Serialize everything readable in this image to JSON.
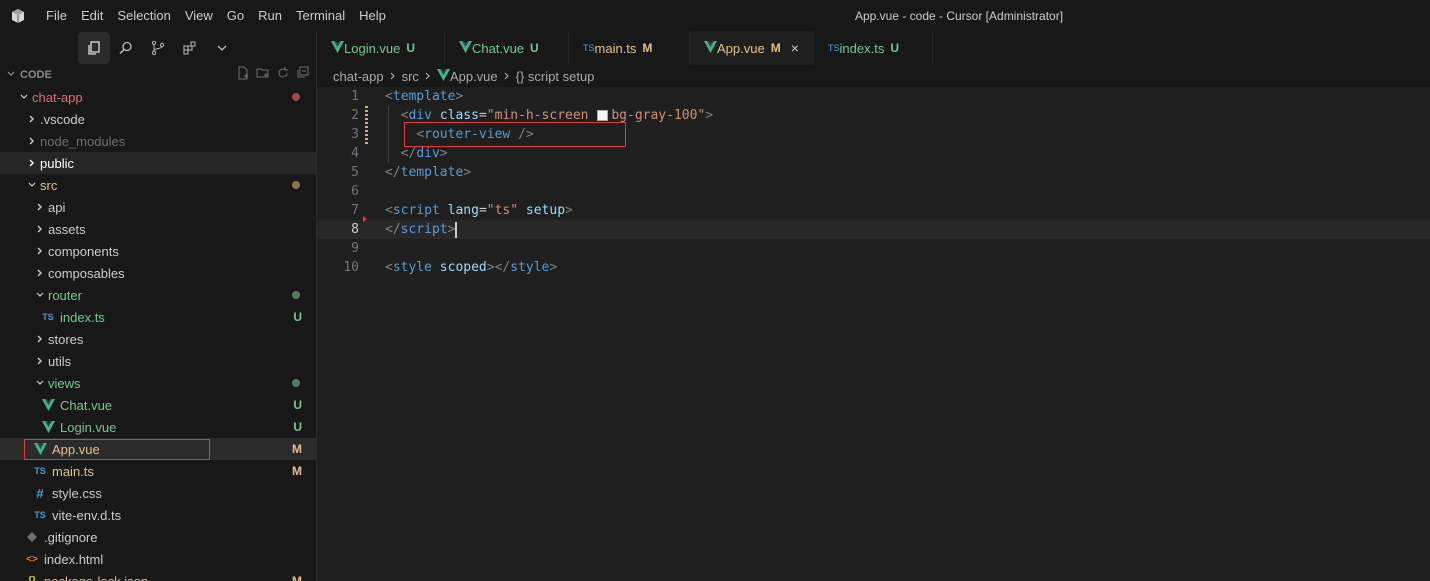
{
  "titlebar": {
    "menu": [
      "File",
      "Edit",
      "Selection",
      "View",
      "Go",
      "Run",
      "Terminal",
      "Help"
    ],
    "window_title": "App.vue - code - Cursor [Administrator]"
  },
  "sidebar": {
    "icons": [
      "files-icon",
      "search-icon",
      "source-control-icon",
      "extensions-icon",
      "chevron-down-icon"
    ],
    "section_title": "CODE",
    "tree": [
      {
        "label": "chat-app",
        "kind": "folder-open",
        "depth": 0,
        "color": "#e06c75",
        "status": "dot",
        "status_color": "#9b4a4a"
      },
      {
        "label": ".vscode",
        "kind": "folder",
        "depth": 1,
        "color": "#cccccc"
      },
      {
        "label": "node_modules",
        "kind": "folder",
        "depth": 1,
        "color": "#6e6e6e"
      },
      {
        "label": "public",
        "kind": "folder",
        "depth": 1,
        "color": "#ffffff",
        "highlight": true
      },
      {
        "label": "src",
        "kind": "folder-open",
        "depth": 1,
        "color": "#e2c08d",
        "status": "dot",
        "status_color": "#8a7550"
      },
      {
        "label": "api",
        "kind": "folder",
        "depth": 2,
        "color": "#cccccc"
      },
      {
        "label": "assets",
        "kind": "folder",
        "depth": 2,
        "color": "#cccccc"
      },
      {
        "label": "components",
        "kind": "folder",
        "depth": 2,
        "color": "#cccccc"
      },
      {
        "label": "composables",
        "kind": "folder",
        "depth": 2,
        "color": "#cccccc"
      },
      {
        "label": "router",
        "kind": "folder-open",
        "depth": 2,
        "color": "#73c991",
        "status": "dot",
        "status_color": "#4e7a5e"
      },
      {
        "label": "index.ts",
        "kind": "ts",
        "depth": 3,
        "color": "#73c991",
        "status": "U",
        "status_color": "#73c991"
      },
      {
        "label": "stores",
        "kind": "folder",
        "depth": 2,
        "color": "#cccccc"
      },
      {
        "label": "utils",
        "kind": "folder",
        "depth": 2,
        "color": "#cccccc"
      },
      {
        "label": "views",
        "kind": "folder-open",
        "depth": 2,
        "color": "#73c991",
        "status": "dot",
        "status_color": "#4e7a5e"
      },
      {
        "label": "Chat.vue",
        "kind": "vue",
        "depth": 3,
        "color": "#73c991",
        "status": "U",
        "status_color": "#73c991"
      },
      {
        "label": "Login.vue",
        "kind": "vue",
        "depth": 3,
        "color": "#73c991",
        "status": "U",
        "status_color": "#73c991"
      },
      {
        "label": "App.vue",
        "kind": "vue",
        "depth": 2,
        "color": "#e2c08d",
        "status": "M",
        "status_color": "#e2c08d",
        "selected": true
      },
      {
        "label": "main.ts",
        "kind": "ts",
        "depth": 2,
        "color": "#e2c08d",
        "status": "M",
        "status_color": "#e2c08d"
      },
      {
        "label": "style.css",
        "kind": "css",
        "depth": 2,
        "color": "#cccccc"
      },
      {
        "label": "vite-env.d.ts",
        "kind": "ts",
        "depth": 2,
        "color": "#cccccc"
      },
      {
        "label": ".gitignore",
        "kind": "git",
        "depth": 1,
        "color": "#cccccc"
      },
      {
        "label": "index.html",
        "kind": "html",
        "depth": 1,
        "color": "#cccccc"
      },
      {
        "label": "package-lock.json",
        "kind": "json",
        "depth": 1,
        "color": "#e2c08d",
        "status": "M",
        "status_color": "#e2c08d"
      }
    ]
  },
  "tabs": [
    {
      "label": "Login.vue",
      "kind": "vue",
      "mark": "U",
      "label_color": "#73c991",
      "mark_color": "#73c991"
    },
    {
      "label": "Chat.vue",
      "kind": "vue",
      "mark": "U",
      "label_color": "#73c991",
      "mark_color": "#73c991"
    },
    {
      "label": "main.ts",
      "kind": "ts",
      "mark": "M",
      "label_color": "#e2c08d",
      "mark_color": "#e2c08d"
    },
    {
      "label": "App.vue",
      "kind": "vue",
      "mark": "M",
      "label_color": "#e2c08d",
      "mark_color": "#e2c08d",
      "active": true,
      "close": "×"
    },
    {
      "label": "index.ts",
      "kind": "ts",
      "mark": "U",
      "label_color": "#73c991",
      "mark_color": "#73c991"
    }
  ],
  "breadcrumb": [
    "chat-app",
    "src",
    "App.vue",
    "{} script setup"
  ],
  "editor": {
    "current_line": 8,
    "lines": [
      {
        "n": "1",
        "tokens": [
          [
            "tag-br",
            "<"
          ],
          [
            "tag",
            "template"
          ],
          [
            "tag-br",
            ">"
          ]
        ]
      },
      {
        "n": "2",
        "tokens": [
          [
            "plain",
            "  "
          ],
          [
            "tag-br",
            "<"
          ],
          [
            "tag",
            "div"
          ],
          [
            "plain",
            " "
          ],
          [
            "attr",
            "class"
          ],
          [
            "plain",
            "="
          ],
          [
            "str",
            "\"min-h-screen "
          ],
          [
            "swatch",
            ""
          ],
          [
            "str",
            "bg-gray-100\""
          ],
          [
            "tag-br",
            ">"
          ]
        ]
      },
      {
        "n": "3",
        "tokens": [
          [
            "plain",
            "    "
          ],
          [
            "tag-br",
            "<"
          ],
          [
            "tag",
            "router-view"
          ],
          [
            "plain",
            " "
          ],
          [
            "tag-br",
            "/>"
          ]
        ]
      },
      {
        "n": "4",
        "tokens": [
          [
            "plain",
            "  "
          ],
          [
            "tag-br",
            "</"
          ],
          [
            "tag",
            "div"
          ],
          [
            "tag-br",
            ">"
          ]
        ]
      },
      {
        "n": "5",
        "tokens": [
          [
            "tag-br",
            "</"
          ],
          [
            "tag",
            "template"
          ],
          [
            "tag-br",
            ">"
          ]
        ]
      },
      {
        "n": "6",
        "tokens": []
      },
      {
        "n": "7",
        "tokens": [
          [
            "tag-br",
            "<"
          ],
          [
            "tag",
            "script"
          ],
          [
            "plain",
            " "
          ],
          [
            "attr",
            "lang"
          ],
          [
            "plain",
            "="
          ],
          [
            "str",
            "\"ts\""
          ],
          [
            "plain",
            " "
          ],
          [
            "attr",
            "setup"
          ],
          [
            "tag-br",
            ">"
          ]
        ]
      },
      {
        "n": "8",
        "tokens": [
          [
            "tag-br",
            "</"
          ],
          [
            "tag",
            "script"
          ],
          [
            "tag-br",
            ">"
          ],
          [
            "caret",
            ""
          ]
        ]
      },
      {
        "n": "9",
        "tokens": []
      },
      {
        "n": "10",
        "tokens": [
          [
            "tag-br",
            "<"
          ],
          [
            "tag",
            "style"
          ],
          [
            "plain",
            " "
          ],
          [
            "attr",
            "scoped"
          ],
          [
            "tag-br",
            "></"
          ],
          [
            "tag",
            "style"
          ],
          [
            "tag-br",
            ">"
          ]
        ]
      }
    ]
  },
  "colors": {
    "accent_red": "#e0393e",
    "untracked_green": "#73c991",
    "modified_yellow": "#e2c08d"
  }
}
